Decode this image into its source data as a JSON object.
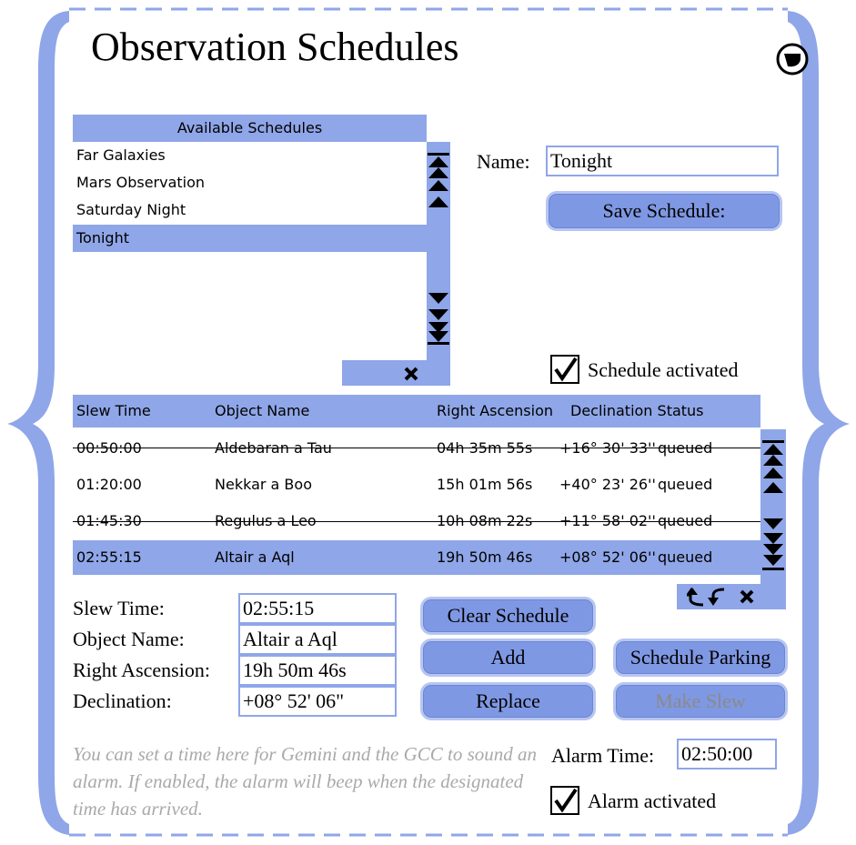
{
  "title": "Observation Schedules",
  "icons": {
    "close": "close-icon"
  },
  "available": {
    "header": "Available Schedules",
    "items": [
      "Far Galaxies",
      "Mars Observation",
      "Saturday Night",
      "Tonight"
    ],
    "selected_index": 3
  },
  "name_field": {
    "label": "Name:",
    "value": "Tonight"
  },
  "save_button": "Save Schedule:",
  "schedule_activated": {
    "label": "Schedule activated",
    "checked": true
  },
  "table": {
    "headers": [
      "Slew Time",
      "Object Name",
      "Right Ascension",
      "Declination Status"
    ],
    "rows": [
      {
        "slew": "00:50:00",
        "object": "Aldebaran a Tau",
        "ra": "04h 35m 55s",
        "dec": "+16° 30' 33''",
        "status": "queued",
        "struck": true
      },
      {
        "slew": "01:20:00",
        "object": "Nekkar a Boo",
        "ra": "15h 01m 56s",
        "dec": "+40° 23' 26''",
        "status": "queued",
        "struck": false
      },
      {
        "slew": "01:45:30",
        "object": "Regulus a Leo",
        "ra": "10h 08m 22s",
        "dec": "+11° 58' 02''",
        "status": "queued",
        "struck": true
      },
      {
        "slew": "02:55:15",
        "object": "Altair a Aql",
        "ra": "19h 50m 46s",
        "dec": "+08° 52' 06''",
        "status": "queued",
        "struck": false
      }
    ],
    "selected_index": 3
  },
  "detail": {
    "slew_label": "Slew Time:",
    "slew_value": "02:55:15",
    "object_label": "Object Name:",
    "object_value": "Altair a Aql",
    "ra_label": "Right Ascension:",
    "ra_value": "19h 50m 46s",
    "dec_label": "Declination:",
    "dec_value": "+08° 52' 06\""
  },
  "buttons": {
    "clear": "Clear Schedule",
    "add": "Add",
    "replace": "Replace",
    "parking": "Schedule Parking",
    "make_slew": "Make Slew"
  },
  "hint": "You can set a time here for Gemini and the GCC to sound an alarm. If enabled, the alarm will beep when the designated time has arrived.",
  "alarm": {
    "label": "Alarm Time:",
    "value": "02:50:00",
    "activated_label": "Alarm activated",
    "activated": true
  },
  "colors": {
    "accent": "#8fa6e8",
    "button": "#7f98e3",
    "frame": "#8fa6e8"
  }
}
